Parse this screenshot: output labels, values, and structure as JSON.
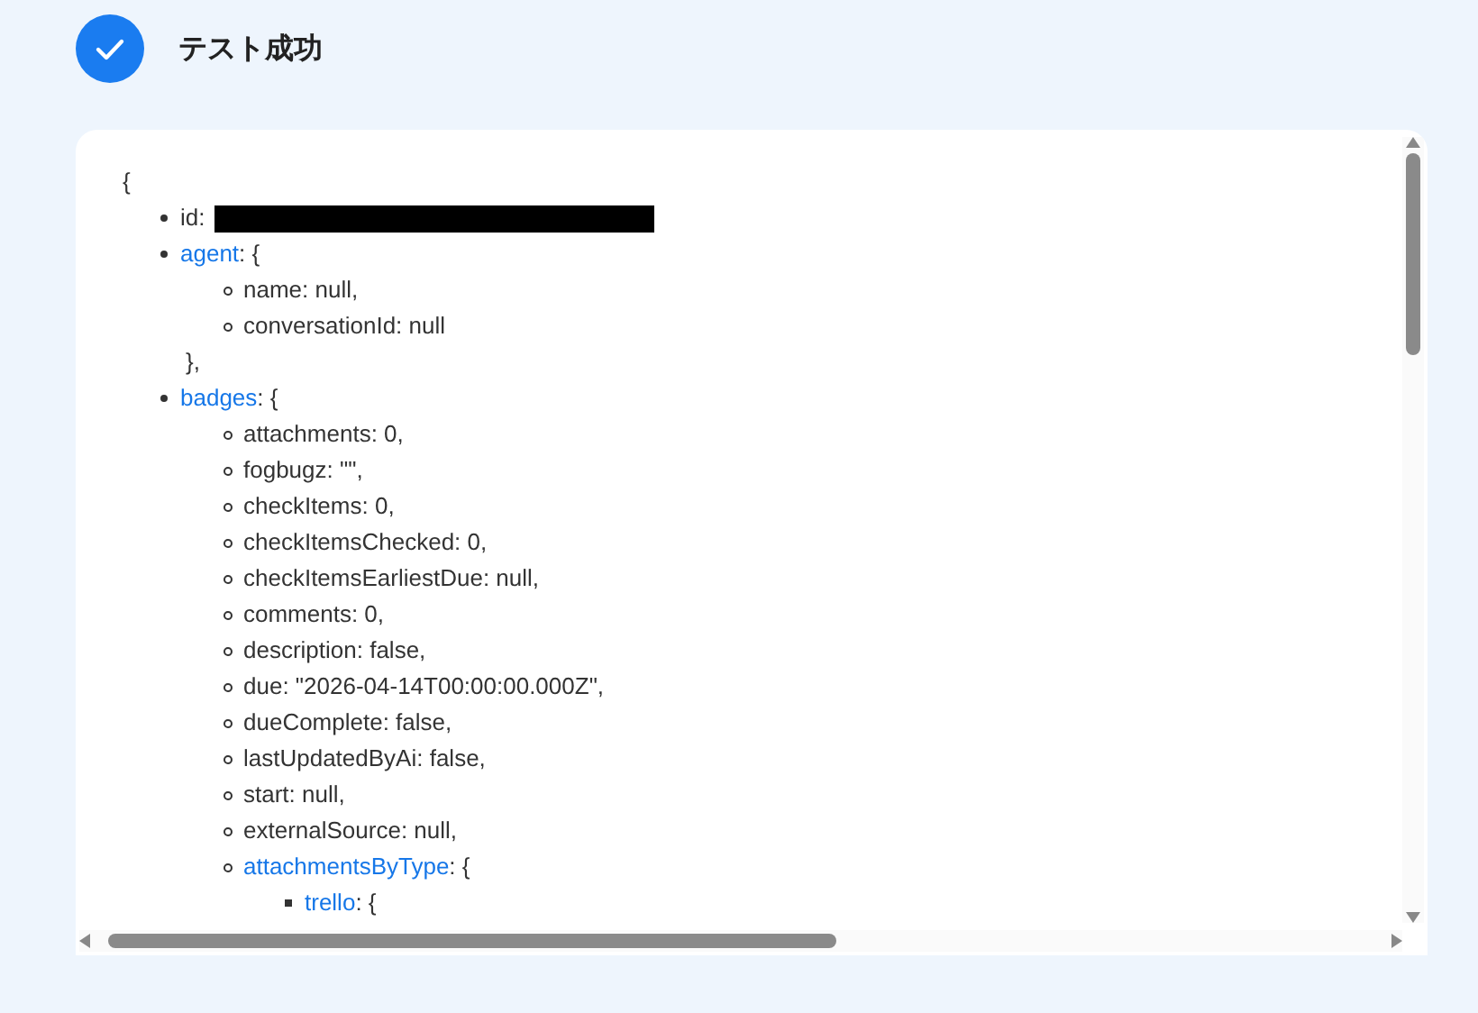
{
  "header": {
    "title": "テスト成功"
  },
  "viewer": {
    "open": "{",
    "items": [
      {
        "text": "id:",
        "redacted": true
      },
      {
        "key": "agent",
        "text": ": {",
        "close": "},",
        "children": [
          {
            "text": "name: null,"
          },
          {
            "text": "conversationId: null"
          }
        ]
      },
      {
        "key": "badges",
        "text": ": {",
        "children": [
          {
            "text": "attachments: 0,"
          },
          {
            "text": "fogbugz: \"\","
          },
          {
            "text": "checkItems: 0,"
          },
          {
            "text": "checkItemsChecked: 0,"
          },
          {
            "text": "checkItemsEarliestDue: null,"
          },
          {
            "text": "comments: 0,"
          },
          {
            "text": "description: false,"
          },
          {
            "text": "due: \"2026-04-14T00:00:00.000Z\","
          },
          {
            "text": "dueComplete: false,"
          },
          {
            "text": "lastUpdatedByAi: false,"
          },
          {
            "text": "start: null,"
          },
          {
            "text": "externalSource: null,"
          },
          {
            "key": "attachmentsByType",
            "text": ": {",
            "children": [
              {
                "key": "trello",
                "text": ": {"
              }
            ]
          }
        ]
      }
    ]
  }
}
